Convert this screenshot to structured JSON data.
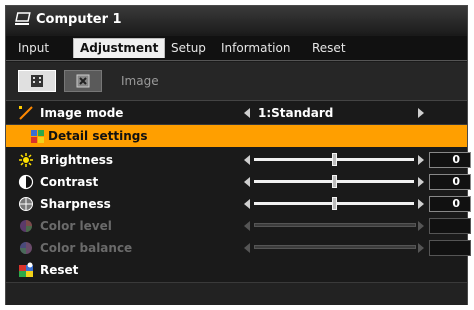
{
  "title": {
    "text": "Computer 1"
  },
  "tabs": [
    {
      "label": "Input",
      "active": false
    },
    {
      "label": "Adjustment",
      "active": true
    },
    {
      "label": "Setup",
      "active": false
    },
    {
      "label": "Information",
      "active": false
    },
    {
      "label": "Reset",
      "active": false
    }
  ],
  "subbar": {
    "label": "Image"
  },
  "image_mode": {
    "label": "Image mode",
    "value": "1:Standard"
  },
  "detail_settings": {
    "label": "Detail settings"
  },
  "sliders": [
    {
      "label": "Brightness",
      "value": "0",
      "level": 0.5,
      "enabled": true
    },
    {
      "label": "Contrast",
      "value": "0",
      "level": 0.5,
      "enabled": true
    },
    {
      "label": "Sharpness",
      "value": "0",
      "level": 0.5,
      "enabled": true
    },
    {
      "label": "Color level",
      "value": "",
      "level": null,
      "enabled": false
    },
    {
      "label": "Color balance",
      "value": "",
      "level": null,
      "enabled": false
    }
  ],
  "reset": {
    "label": "Reset"
  },
  "colors": {
    "highlight": "#ff9f00",
    "background": "#1a1a1a"
  }
}
